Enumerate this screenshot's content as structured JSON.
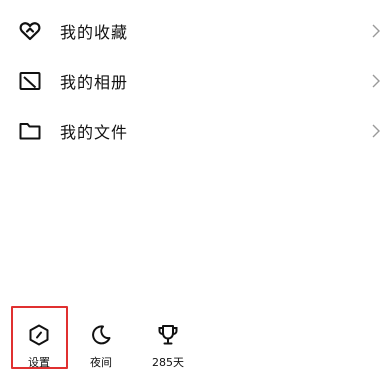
{
  "menu": {
    "items": [
      {
        "label": "我的收藏",
        "icon": "heart-icon"
      },
      {
        "label": "我的相册",
        "icon": "album-icon"
      },
      {
        "label": "我的文件",
        "icon": "folder-icon"
      }
    ]
  },
  "bottom_bar": {
    "settings_label": "设置",
    "night_label": "夜间",
    "days_label": "285天"
  },
  "colors": {
    "highlight": "#e03030",
    "chevron": "#9a9a9a",
    "text": "#111111"
  }
}
